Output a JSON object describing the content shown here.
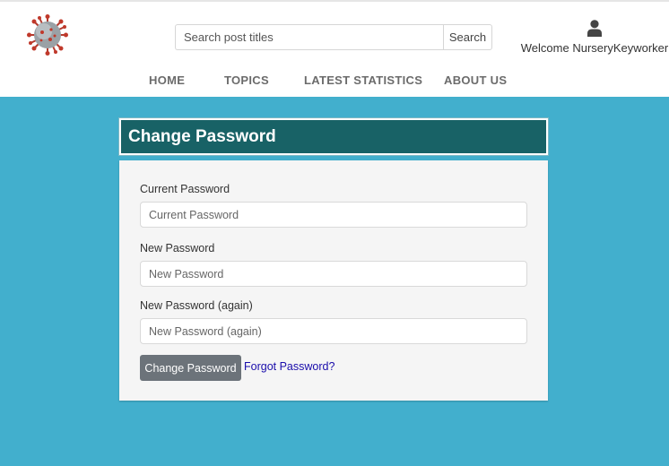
{
  "header": {
    "logo_icon": "coronavirus-icon",
    "search": {
      "placeholder": "Search post titles",
      "value": "",
      "button_label": "Search"
    },
    "user": {
      "icon": "user-icon",
      "welcome_text": "Welcome NurseryKeyworker"
    },
    "nav": [
      {
        "label": "HOME"
      },
      {
        "label": "TOPICS"
      },
      {
        "label": "LATEST STATISTICS"
      },
      {
        "label": "ABOUT US"
      }
    ]
  },
  "form": {
    "title": "Change Password",
    "fields": [
      {
        "label": "Current Password",
        "placeholder": "Current Password",
        "value": ""
      },
      {
        "label": "New Password",
        "placeholder": "New Password",
        "value": ""
      },
      {
        "label": "New Password (again)",
        "placeholder": "New Password (again)",
        "value": ""
      }
    ],
    "submit_label": "Change Password",
    "forgot_link": "Forgot Password?"
  },
  "colors": {
    "page_background": "#42afcd",
    "title_bar": "#186266",
    "button": "#6c737a",
    "link": "#1a0dab"
  }
}
